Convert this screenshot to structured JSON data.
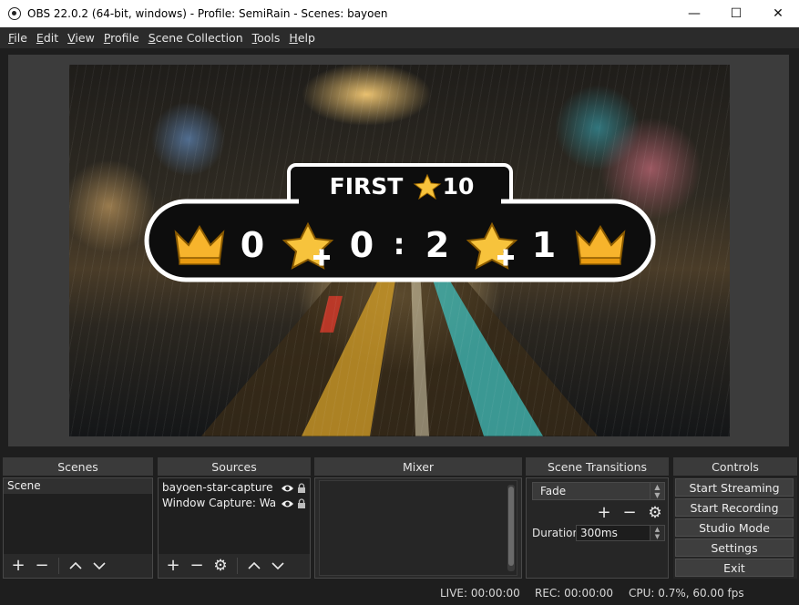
{
  "window": {
    "title": "OBS 22.0.2 (64-bit, windows) - Profile: SemiRain - Scenes: bayoen",
    "controls": [
      "minimize",
      "maximize",
      "close"
    ]
  },
  "menu": [
    {
      "label": "File",
      "accel": "F",
      "rest": "ile"
    },
    {
      "label": "Edit",
      "accel": "E",
      "rest": "dit"
    },
    {
      "label": "View",
      "accel": "V",
      "rest": "iew"
    },
    {
      "label": "Profile",
      "accel": "P",
      "rest": "rofile"
    },
    {
      "label": "Scene Collection",
      "accel": "S",
      "rest": "cene Collection"
    },
    {
      "label": "Tools",
      "accel": "T",
      "rest": "ools"
    },
    {
      "label": "Help",
      "accel": "H",
      "rest": "elp"
    }
  ],
  "scoreboard": {
    "header_first": "FIRST",
    "header_star_count": "10",
    "left_score": "0",
    "left_stars": "0",
    "separator": ":",
    "right_stars": "2",
    "right_score": "1"
  },
  "docks": {
    "scenes": {
      "title": "Scenes",
      "items": [
        "Scene"
      ]
    },
    "sources": {
      "title": "Sources",
      "items": [
        "bayoen-star-capture",
        "Window Capture: Wa"
      ]
    },
    "mixer": {
      "title": "Mixer"
    },
    "transitions": {
      "title": "Scene Transitions",
      "selected": "Fade",
      "duration_label": "Duration",
      "duration_value": "300ms"
    },
    "controls": {
      "title": "Controls",
      "buttons": [
        "Start Streaming",
        "Start Recording",
        "Studio Mode",
        "Settings",
        "Exit"
      ]
    }
  },
  "status": {
    "live": "LIVE: 00:00:00",
    "rec": "REC: 00:00:00",
    "cpu": "CPU: 0.7%, 60.00 fps"
  }
}
